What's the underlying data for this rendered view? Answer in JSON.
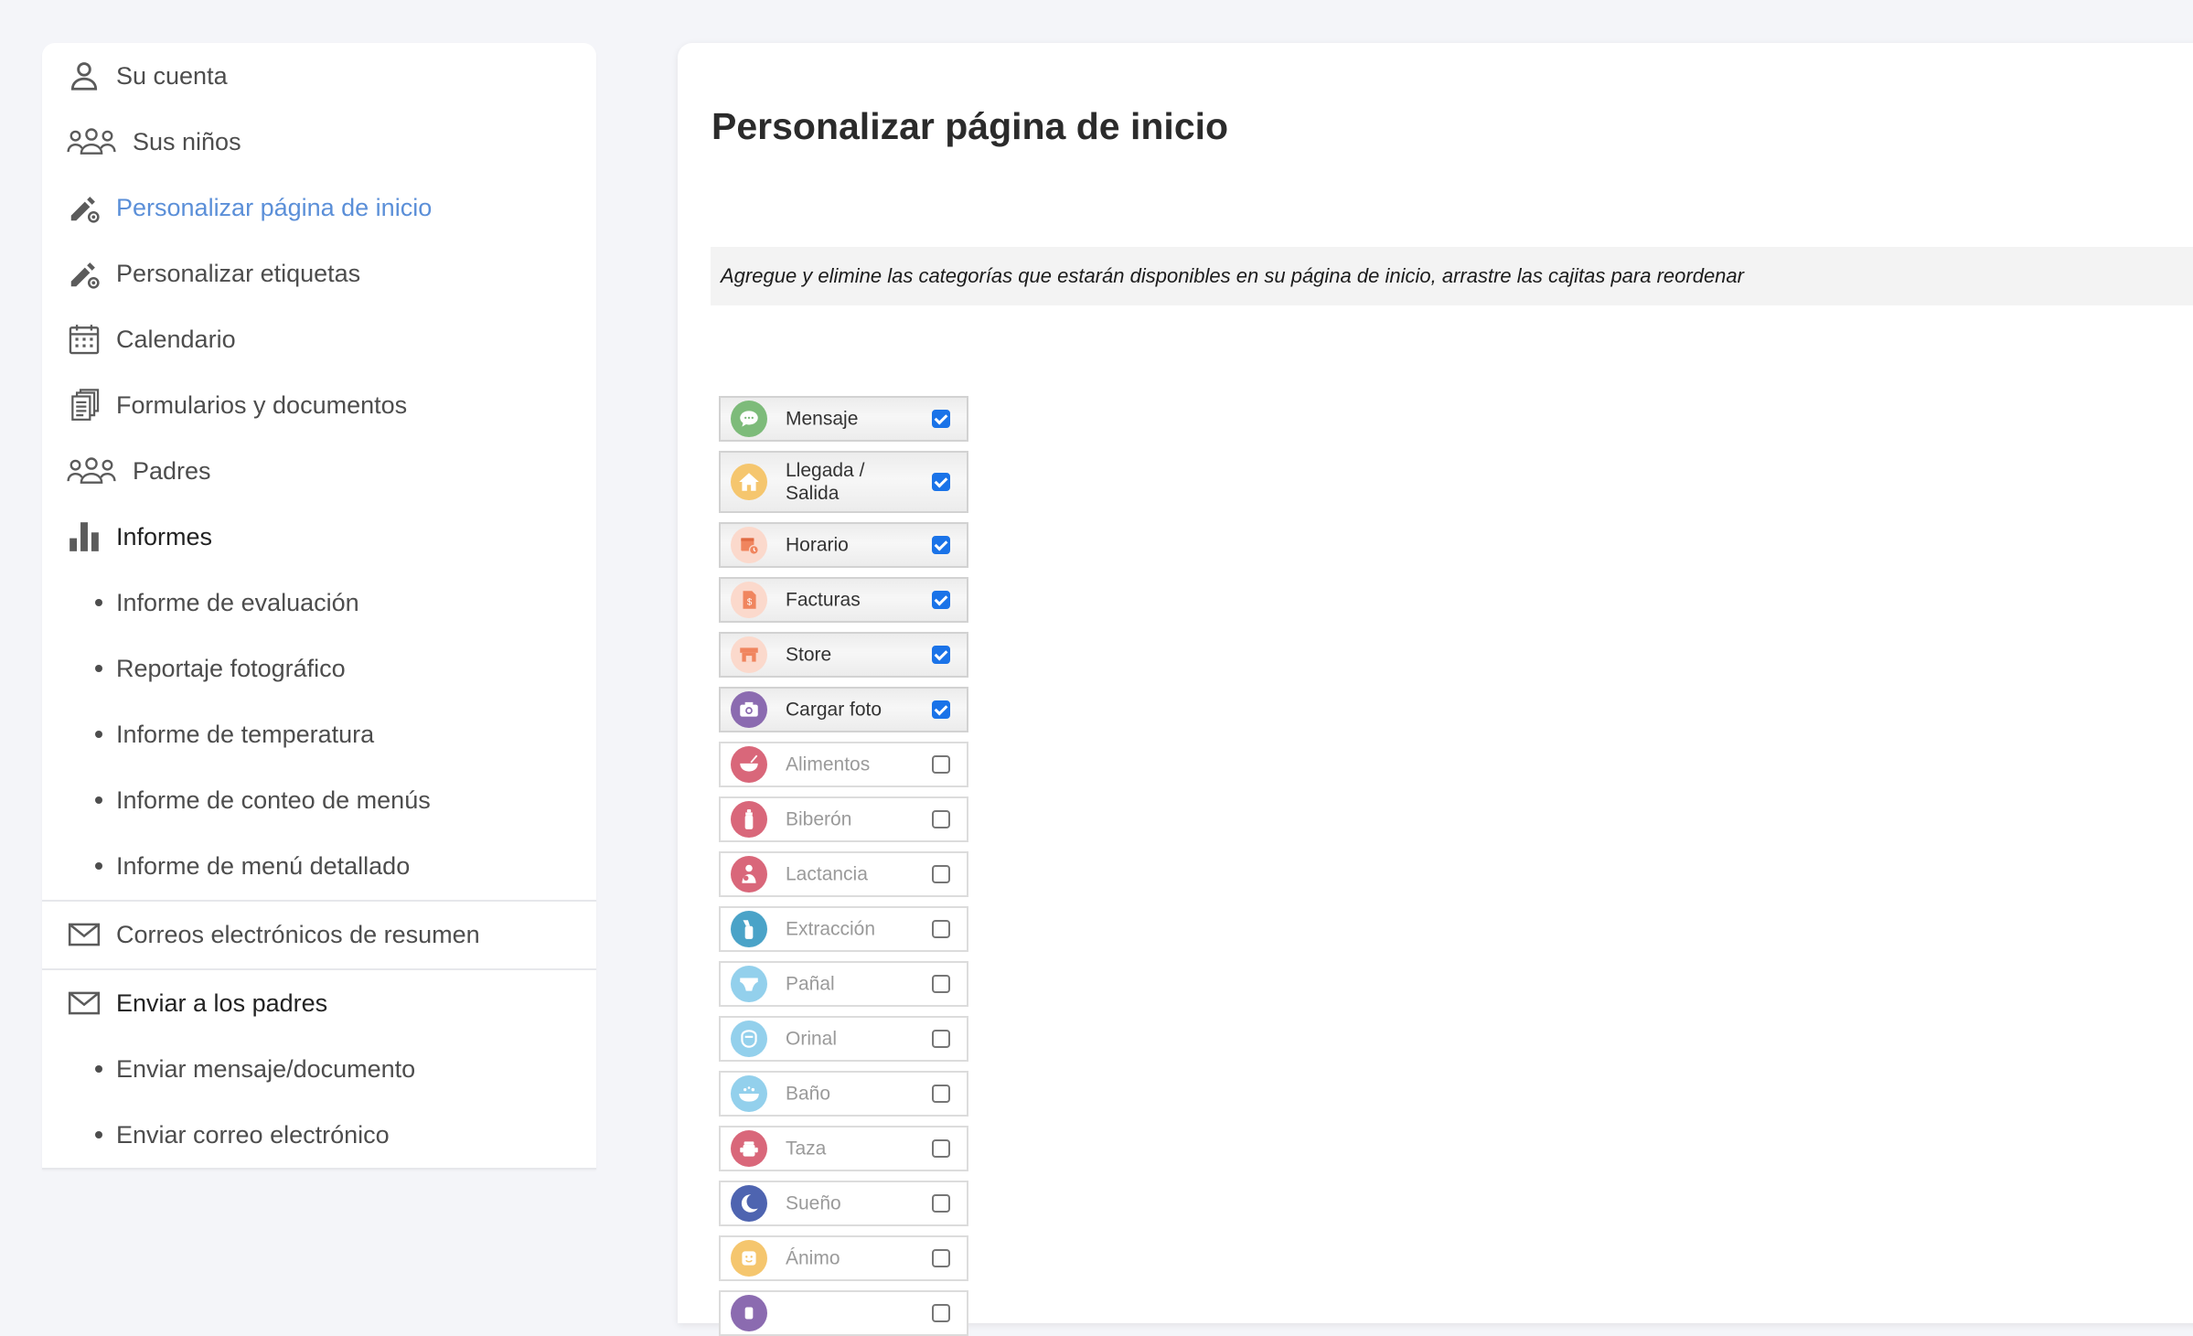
{
  "sidebar": {
    "items": [
      {
        "label": "Su cuenta",
        "icon": "user-icon"
      },
      {
        "label": "Sus niños",
        "icon": "group-icon"
      },
      {
        "label": "Personalizar página de inicio",
        "icon": "edit-settings-icon",
        "active": true
      },
      {
        "label": "Personalizar etiquetas",
        "icon": "edit-settings-icon"
      },
      {
        "label": "Calendario",
        "icon": "calendar-icon"
      },
      {
        "label": "Formularios y documentos",
        "icon": "documents-icon"
      },
      {
        "label": "Padres",
        "icon": "group-icon"
      },
      {
        "label": "Informes",
        "icon": "bar-chart-icon"
      }
    ],
    "report_subitems": [
      "Informe de evaluación",
      "Reportaje fotográfico",
      "Informe de temperatura",
      "Informe de conteo de menús",
      "Informe de menú detallado"
    ],
    "summary_emails": {
      "label": "Correos electrónicos de resumen",
      "icon": "mail-icon"
    },
    "send_to_parents": {
      "label": "Enviar a los padres",
      "icon": "mail-icon"
    },
    "send_subitems": [
      "Enviar mensaje/documento",
      "Enviar correo electrónico"
    ]
  },
  "main": {
    "title": "Personalizar página de inicio",
    "instructions": "Agregue y elimine las categorías que estarán disponibles en su página de inicio, arrastre las cajitas para reordenar"
  },
  "categories": [
    {
      "label": "Mensaje",
      "checked": true,
      "color": "#7dbb7a",
      "icon": "chat-icon"
    },
    {
      "label": "Llegada / Salida",
      "checked": true,
      "color": "#f5c66e",
      "icon": "home-icon"
    },
    {
      "label": "Horario",
      "checked": true,
      "color": "#fbd9cc",
      "icon": "schedule-icon"
    },
    {
      "label": "Facturas",
      "checked": true,
      "color": "#fbd9cc",
      "icon": "invoice-icon"
    },
    {
      "label": "Store",
      "checked": true,
      "color": "#fbd9cc",
      "icon": "store-icon"
    },
    {
      "label": "Cargar foto",
      "checked": true,
      "color": "#8b6bb0",
      "icon": "camera-icon"
    },
    {
      "label": "Alimentos",
      "checked": false,
      "color": "#d9677a",
      "icon": "food-bowl-icon"
    },
    {
      "label": "Biberón",
      "checked": false,
      "color": "#d9677a",
      "icon": "bottle-icon"
    },
    {
      "label": "Lactancia",
      "checked": false,
      "color": "#d9677a",
      "icon": "nursing-icon"
    },
    {
      "label": "Extracción",
      "checked": false,
      "color": "#4aa3c8",
      "icon": "pump-icon"
    },
    {
      "label": "Pañal",
      "checked": false,
      "color": "#93d0ec",
      "icon": "diaper-icon"
    },
    {
      "label": "Orinal",
      "checked": false,
      "color": "#93d0ec",
      "icon": "potty-icon"
    },
    {
      "label": "Baño",
      "checked": false,
      "color": "#93d0ec",
      "icon": "bath-icon"
    },
    {
      "label": "Taza",
      "checked": false,
      "color": "#d9677a",
      "icon": "cup-icon"
    },
    {
      "label": "Sueño",
      "checked": false,
      "color": "#4e64b0",
      "icon": "moon-icon"
    },
    {
      "label": "Ánimo",
      "checked": false,
      "color": "#f5c66e",
      "icon": "mood-icon"
    },
    {
      "label": "",
      "checked": false,
      "color": "#8b6bb0",
      "icon": "generic-icon"
    }
  ]
}
